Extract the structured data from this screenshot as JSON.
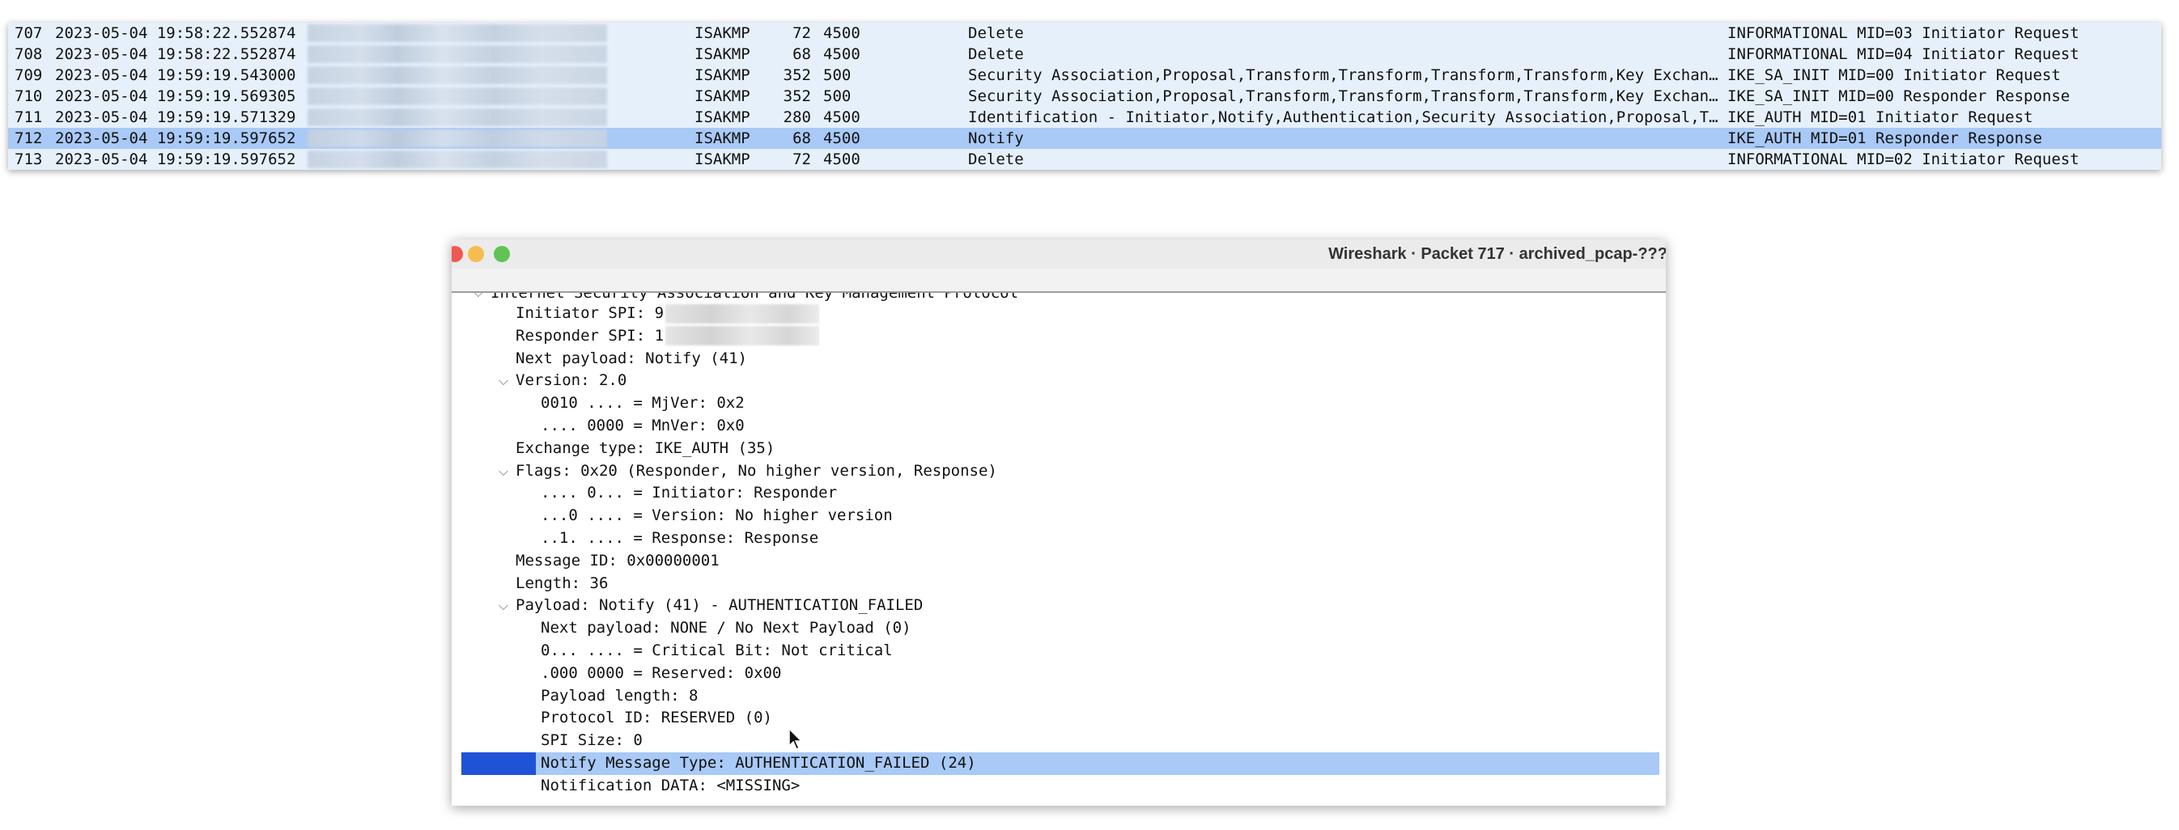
{
  "packet_list": {
    "rows": [
      {
        "no": "707",
        "time": "2023-05-04 19:58:22.552874",
        "protocol": "ISAKMP",
        "length": "72",
        "info_port": "4500",
        "info_payloads": "Delete",
        "info_summary": "INFORMATIONAL MID=03 Initiator Request",
        "selected": false
      },
      {
        "no": "708",
        "time": "2023-05-04 19:58:22.552874",
        "protocol": "ISAKMP",
        "length": "68",
        "info_port": "4500",
        "info_payloads": "Delete",
        "info_summary": "INFORMATIONAL MID=04 Initiator Request",
        "selected": false
      },
      {
        "no": "709",
        "time": "2023-05-04 19:59:19.543000",
        "protocol": "ISAKMP",
        "length": "352",
        "info_port": "500",
        "info_payloads": "Security Association,Proposal,Transform,Transform,Transform,Transform,Key Exchang…",
        "info_summary": "IKE_SA_INIT MID=00 Initiator Request",
        "selected": false
      },
      {
        "no": "710",
        "time": "2023-05-04 19:59:19.569305",
        "protocol": "ISAKMP",
        "length": "352",
        "info_port": "500",
        "info_payloads": "Security Association,Proposal,Transform,Transform,Transform,Transform,Key Exchang…",
        "info_summary": "IKE_SA_INIT MID=00 Responder Response",
        "selected": false
      },
      {
        "no": "711",
        "time": "2023-05-04 19:59:19.571329",
        "protocol": "ISAKMP",
        "length": "280",
        "info_port": "4500",
        "info_payloads": "Identification - Initiator,Notify,Authentication,Security Association,Proposal,Tr…",
        "info_summary": "IKE_AUTH MID=01 Initiator Request",
        "selected": false
      },
      {
        "no": "712",
        "time": "2023-05-04 19:59:19.597652",
        "protocol": "ISAKMP",
        "length": "68",
        "info_port": "4500",
        "info_payloads": "Notify",
        "info_summary": "IKE_AUTH MID=01 Responder Response",
        "selected": true
      },
      {
        "no": "713",
        "time": "2023-05-04 19:59:19.597652",
        "protocol": "ISAKMP",
        "length": "72",
        "info_port": "4500",
        "info_payloads": "Delete",
        "info_summary": "INFORMATIONAL MID=02 Initiator Request",
        "selected": false
      }
    ]
  },
  "detail_window": {
    "title": "Wireshark · Packet 717 · archived_pcap-???",
    "tree": [
      {
        "level": 0,
        "chevron": "v",
        "text": "Internet Security Association and Key Management Protocol",
        "cut": true
      },
      {
        "level": 1,
        "chevron": "",
        "text": "Initiator SPI: 9",
        "redacted": true
      },
      {
        "level": 1,
        "chevron": "",
        "text": "Responder SPI: 1",
        "redacted": true
      },
      {
        "level": 1,
        "chevron": "",
        "text": "Next payload: Notify (41)"
      },
      {
        "level": 1,
        "chevron": "v",
        "text": "Version: 2.0"
      },
      {
        "level": 2,
        "chevron": "",
        "text": "0010 .... = MjVer: 0x2"
      },
      {
        "level": 2,
        "chevron": "",
        "text": ".... 0000 = MnVer: 0x0"
      },
      {
        "level": 1,
        "chevron": "",
        "text": "Exchange type: IKE_AUTH (35)"
      },
      {
        "level": 1,
        "chevron": "v",
        "text": "Flags: 0x20 (Responder, No higher version, Response)"
      },
      {
        "level": 2,
        "chevron": "",
        "text": ".... 0... = Initiator: Responder"
      },
      {
        "level": 2,
        "chevron": "",
        "text": "...0 .... = Version: No higher version"
      },
      {
        "level": 2,
        "chevron": "",
        "text": "..1. .... = Response: Response"
      },
      {
        "level": 1,
        "chevron": "",
        "text": "Message ID: 0x00000001"
      },
      {
        "level": 1,
        "chevron": "",
        "text": "Length: 36"
      },
      {
        "level": 1,
        "chevron": "v",
        "text": "Payload: Notify (41) - AUTHENTICATION_FAILED"
      },
      {
        "level": 2,
        "chevron": "",
        "text": "Next payload: NONE / No Next Payload  (0)"
      },
      {
        "level": 2,
        "chevron": "",
        "text": "0... .... = Critical Bit: Not critical"
      },
      {
        "level": 2,
        "chevron": "",
        "text": ".000 0000 = Reserved: 0x00"
      },
      {
        "level": 2,
        "chevron": "",
        "text": "Payload length: 8"
      },
      {
        "level": 2,
        "chevron": "",
        "text": "Protocol ID: RESERVED (0)"
      },
      {
        "level": 2,
        "chevron": "",
        "text": "SPI Size: 0"
      },
      {
        "level": 2,
        "chevron": "",
        "text": "Notify Message Type: AUTHENTICATION_FAILED (24)",
        "selected": true
      },
      {
        "level": 2,
        "chevron": "",
        "text": "Notification DATA: <MISSING>"
      }
    ]
  },
  "colors": {
    "list_bg": "#e6f0fb",
    "selection": "#a9c9f6",
    "selection_marker": "#1f53d6",
    "close": "#ee5a52",
    "minimize": "#f5bd4f",
    "maximize": "#5fc454"
  },
  "icons": {
    "cursor": "mouse-pointer-icon",
    "expander": "chevron-down-icon"
  }
}
